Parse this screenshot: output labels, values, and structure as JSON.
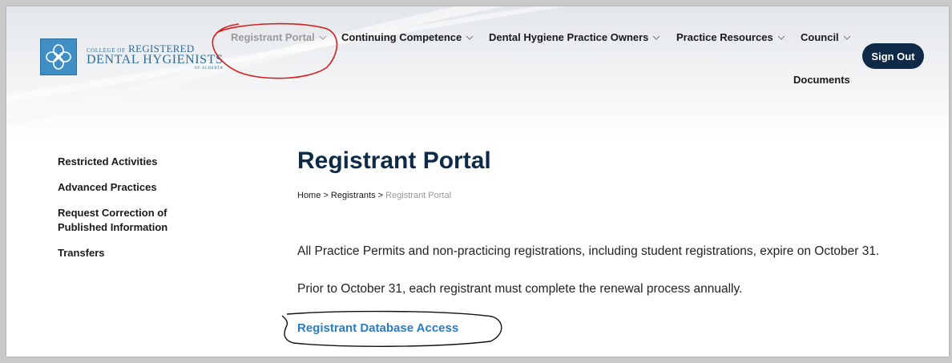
{
  "logo": {
    "line1_small": "COLLEGE OF",
    "line1": "REGISTERED",
    "line2": "DENTAL HYGIENISTS",
    "line3": "OF ALBERTA"
  },
  "nav": {
    "items": [
      {
        "label": "Registrant Portal",
        "active": true
      },
      {
        "label": "Continuing Competence"
      },
      {
        "label": "Dental Hygiene Practice Owners"
      },
      {
        "label": "Practice Resources"
      },
      {
        "label": "Council"
      }
    ],
    "documents_label": "Documents",
    "sign_out_label": "Sign Out"
  },
  "sidebar": {
    "items": [
      {
        "label": "Restricted Activities"
      },
      {
        "label": "Advanced Practices"
      },
      {
        "label": "Request Correction of Published Information"
      },
      {
        "label": "Transfers"
      }
    ]
  },
  "main": {
    "title": "Registrant Portal",
    "breadcrumb": {
      "home": "Home",
      "sep": ">",
      "registrants": "Registrants",
      "current": "Registrant Portal"
    },
    "paragraph1": "All Practice Permits and non-practicing registrations, including student registrations, expire on October 31.",
    "paragraph2": "Prior to October 31, each registrant must complete the renewal process annually.",
    "database_link": "Registrant Database Access"
  },
  "colors": {
    "brand_navy": "#0e2a47",
    "link_blue": "#2a7cc4",
    "nav_active_gray": "#9a9a9a",
    "annotation_red": "#d42020",
    "annotation_black": "#111111"
  },
  "icons": {
    "logo": "flower-logo-icon",
    "nav_chevron": "chevron-down-icon"
  }
}
